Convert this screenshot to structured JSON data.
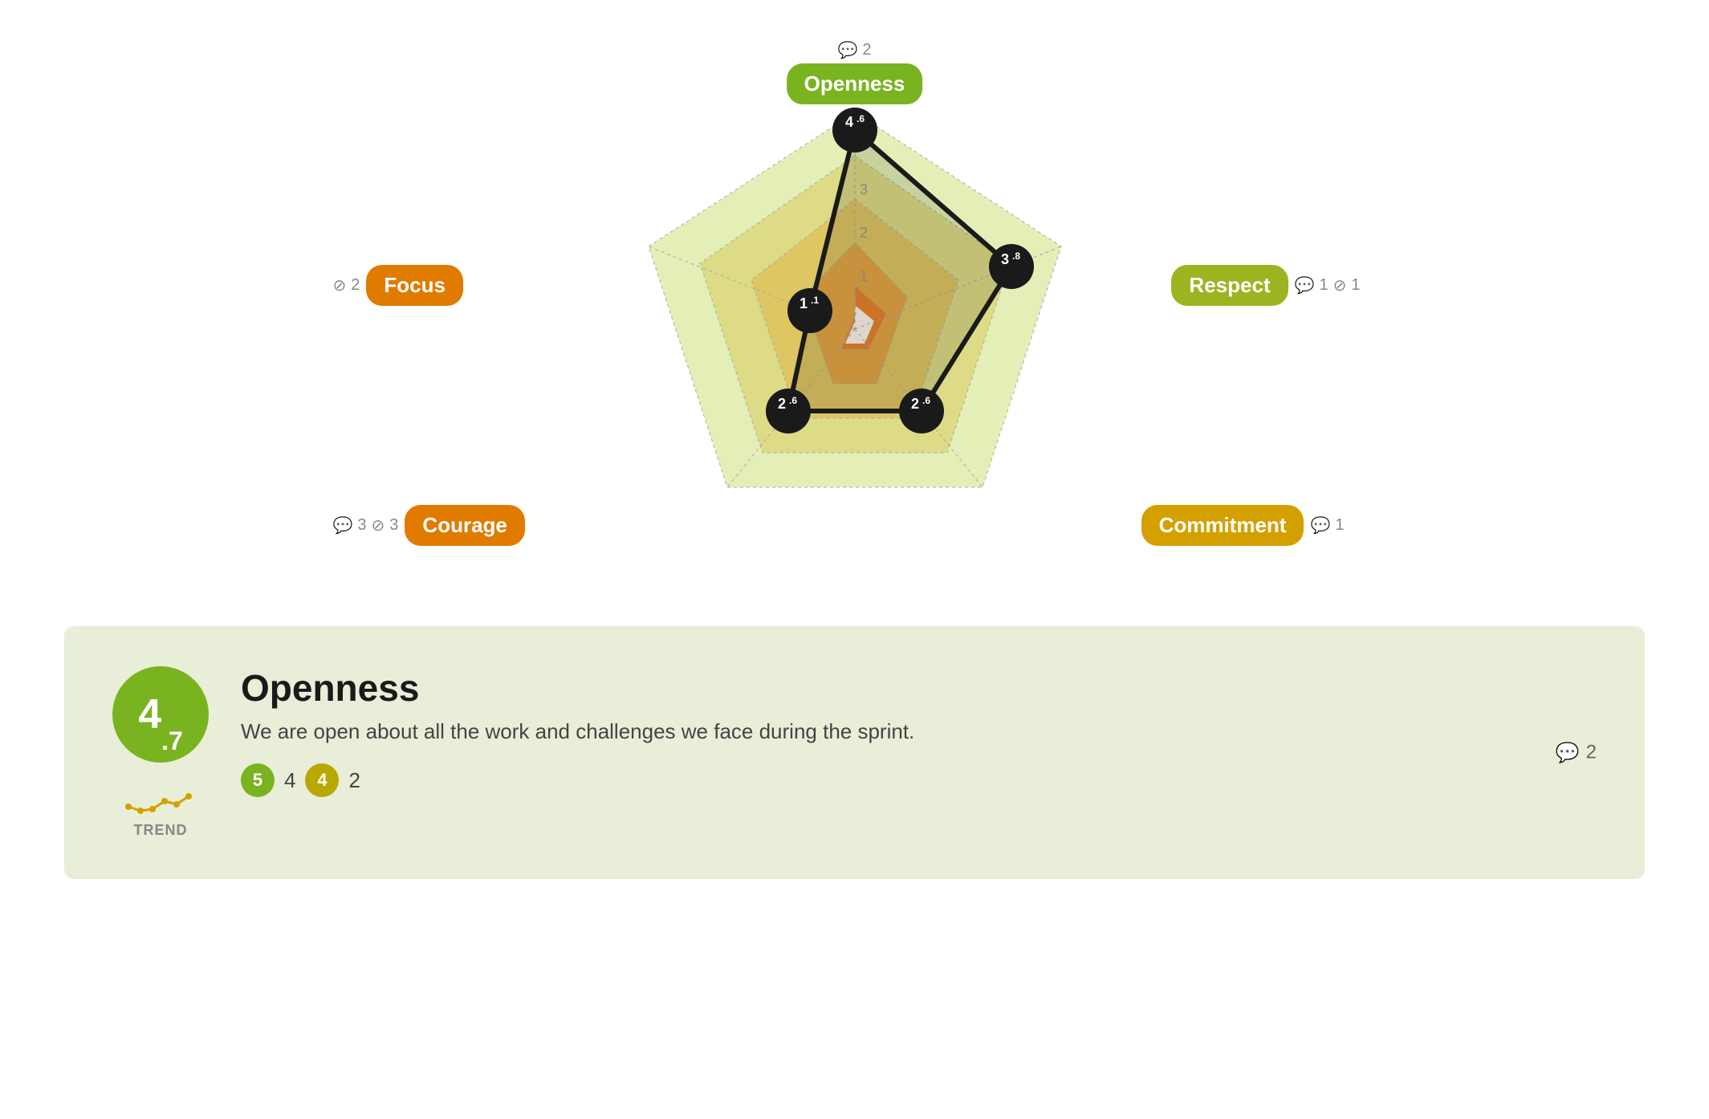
{
  "radar": {
    "labels": {
      "openness": {
        "text": "Openness",
        "color": "green",
        "comments": "2",
        "position": "top"
      },
      "respect": {
        "text": "Respect",
        "color": "yellow-green",
        "comments": "1",
        "votes": "1",
        "position": "right"
      },
      "commitment": {
        "text": "Commitment",
        "color": "yellow",
        "comments": "1",
        "position": "bottom-right"
      },
      "courage": {
        "text": "Courage",
        "color": "orange",
        "comments": "3",
        "votes": "3",
        "position": "bottom-left"
      },
      "focus": {
        "text": "Focus",
        "color": "orange",
        "votes": "2",
        "position": "left"
      }
    },
    "scores": {
      "openness": "4.6",
      "respect": "3.8",
      "commitment": "2.6",
      "courage": "2.6",
      "focus": "1.1"
    },
    "grid_labels": [
      "1",
      "2",
      "3"
    ]
  },
  "card": {
    "score": "4",
    "score_sub": ".7",
    "title": "Openness",
    "description": "We are open about all the work and challenges we face during the sprint.",
    "comments": "2",
    "pills": [
      "5",
      "4",
      "4",
      "2"
    ],
    "pill_colors": [
      "green",
      "text",
      "olive",
      "text"
    ],
    "trend_label": "TREND"
  },
  "icons": {
    "comment": "💬",
    "vote": "⊘"
  }
}
